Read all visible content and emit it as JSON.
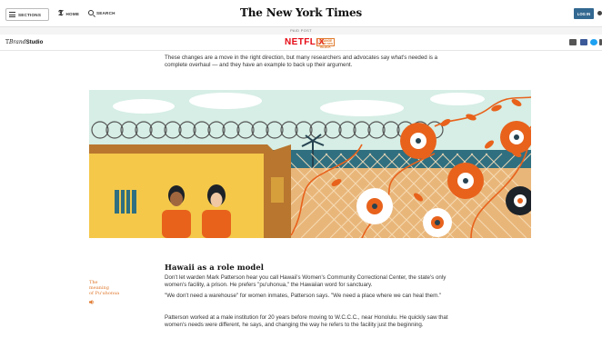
{
  "topbar": {
    "sections_label": "SECTIONS",
    "home_label": "HOME",
    "search_label": "SEARCH",
    "masthead": "The New York Times",
    "login_label": "LOG IN"
  },
  "paid_strip": {
    "label": "PAID POST"
  },
  "sponsor": {
    "brand_prefix": "T",
    "brand_brand": "Brand",
    "brand_studio": "Studio",
    "netflix": "NETFLIX",
    "badge_line1": "ORANGE",
    "badge_line2": "is the new",
    "badge_line3": "BLACK"
  },
  "article": {
    "intro": "These changes are a move in the right direction, but many researchers and advocates say what's needed is a complete overhaul — and they have an example to back up their argument.",
    "section_title": "Hawaii as a role model",
    "side_label_1": "The",
    "side_label_2": "meaning",
    "side_label_3": "of Pu'uhonua",
    "p1": "Don't let warden Mark Patterson hear you call Hawaii's Women's Community Correctional Center, the state's only women's facility, a prison. He prefers \"pu'uhonua,\" the Hawaiian word for sanctuary.",
    "p2": "\"We don't need a warehouse\" for women inmates, Patterson says. \"We need a place where we can heal them.\"",
    "p3": "Patterson worked at a male institution for 20 years before moving to W.C.C.C., near Honolulu. He quickly saw that women's needs were different, he says, and changing the way he refers to the facility just the beginning."
  },
  "colors": {
    "sky": "#d6eee5",
    "sea": "#2f6f80",
    "wall": "#f5c84a",
    "shade": "#b8762f",
    "sand": "#e9b67a",
    "orange": "#e8621c",
    "navy": "#264250",
    "brand_red": "#e50914",
    "accent": "#e0772c"
  }
}
